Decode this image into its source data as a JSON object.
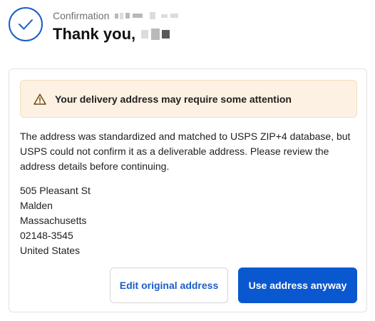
{
  "header": {
    "confirmation_label": "Confirmation",
    "thank_you_text": "Thank you,",
    "check_icon": "checkmark-icon",
    "accent_color": "#1a5dc8"
  },
  "alert": {
    "icon": "warning-icon",
    "text": "Your delivery address may require some attention",
    "background_color": "#fdf1e3"
  },
  "description": "The address was standardized and matched to USPS ZIP+4 database, but USPS could not confirm it as a deliverable address. Please review the address details before continuing.",
  "address": {
    "street": "505 Pleasant St",
    "city": "Malden",
    "state": "Massachusetts",
    "zip": "02148-3545",
    "country": "United States"
  },
  "actions": {
    "edit_label": "Edit original address",
    "use_label": "Use address anyway",
    "primary_color": "#0a58d0"
  }
}
